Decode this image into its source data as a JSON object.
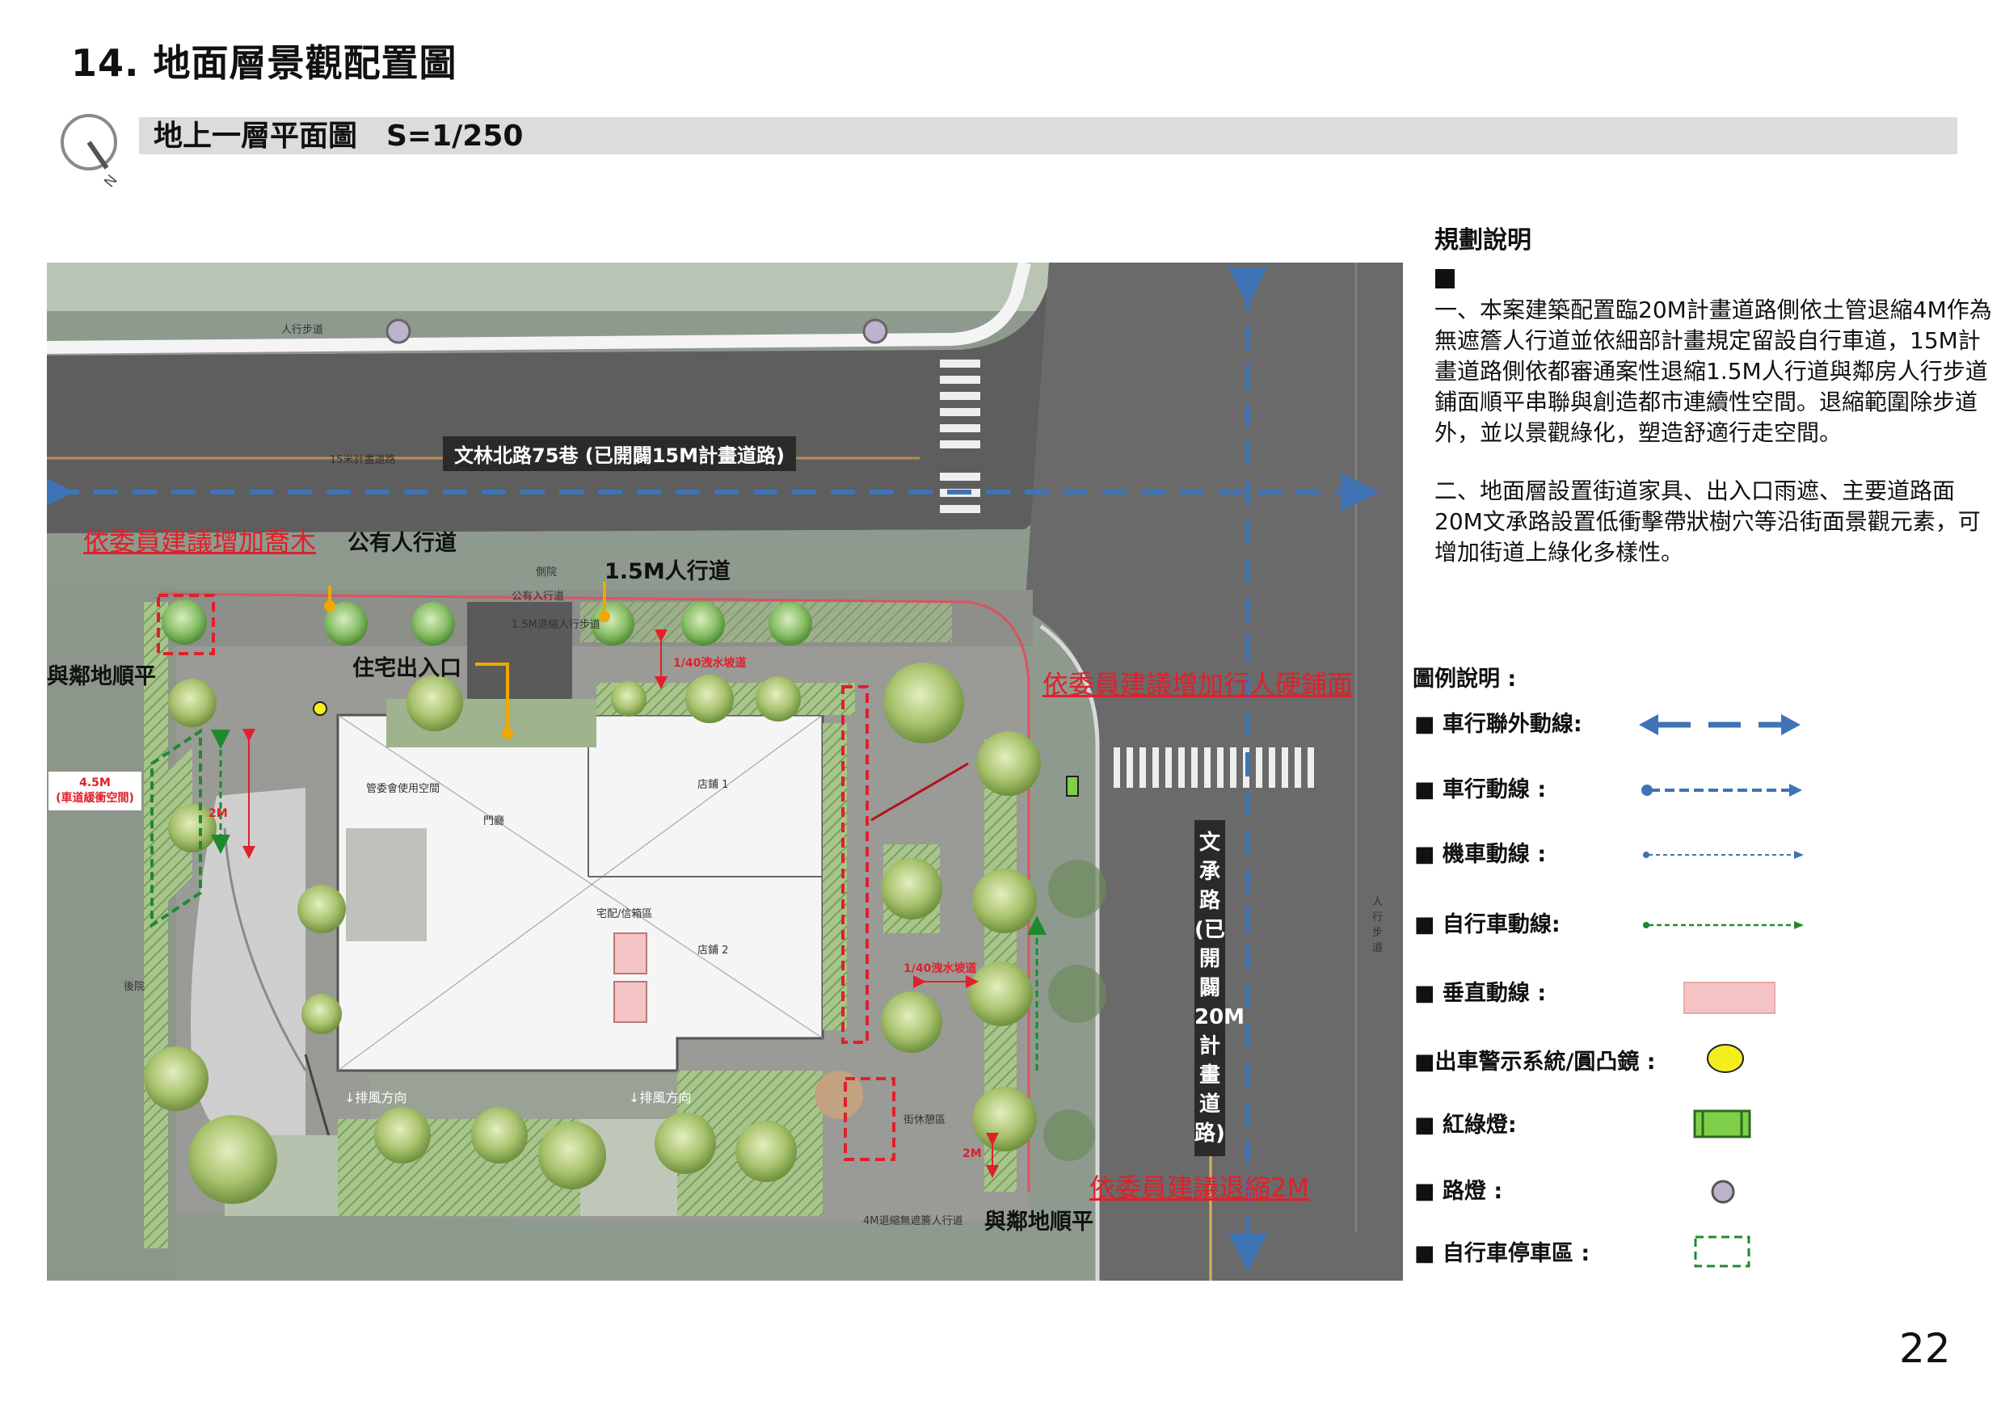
{
  "page": {
    "title": "14. 地面層景觀配置圖",
    "subtitle": "地上一層平面圖　S=1/250",
    "page_number": "22",
    "north_label": "N"
  },
  "notes": {
    "heading": "規劃說明",
    "paragraphs": [
      "一、本案建築配置臨20M計畫道路側依土管退縮4M作為無遮簷人行道並依細部計畫規定留設自行車道，15M計畫道路側依都審通案性退縮1.5M人行道與鄰房人行步道鋪面順平串聯與創造都市連續性空間。退縮範圍除步道外，並以景觀綠化，塑造舒適行走空間。",
      "二、地面層設置街道家具、出入口雨遮、主要道路面20M文承路設置低衝擊帶狀樹穴等沿街面景觀元素，可增加街道上綠化多樣性。"
    ]
  },
  "legend": {
    "heading": "圖例說明 :",
    "items": [
      {
        "label": "車行聯外動線:",
        "symbol": "double-arrow-icon"
      },
      {
        "label": "車行動線 :",
        "symbol": "vehicle-route-icon"
      },
      {
        "label": "機車動線 :",
        "symbol": "scooter-route-icon"
      },
      {
        "label": "自行車動線:",
        "symbol": "bicycle-route-icon"
      },
      {
        "label": "垂直動線 :",
        "symbol": "vertical-circulation-icon"
      },
      {
        "label": "出車警示系統/圓凸鏡 :",
        "symbol": "warning-mirror-icon"
      },
      {
        "label": "紅綠燈:",
        "symbol": "traffic-light-icon"
      },
      {
        "label": "路燈 :",
        "symbol": "street-lamp-icon"
      },
      {
        "label": "自行車停車區 :",
        "symbol": "bicycle-parking-icon"
      }
    ],
    "colors": {
      "vehicle_blue": "#3e73b5",
      "bicycle_green": "#1e8a2e",
      "vertical_pink": "#f4c4c4",
      "warning_yellow": "#f5ee1e",
      "lamp_purple": "#bdb3cc",
      "red_annotation": "#e0202a"
    }
  },
  "plan": {
    "labels": {
      "road_north": "文林北路75巷 (已開闢15M計畫道路)",
      "road_east": "文承路(已開闢20M計畫道路)",
      "add_trees": "依委員建議增加喬木",
      "public_walk": "公有人行道",
      "walk_15m": "1.5M人行道",
      "flush_west": "與鄰地順平",
      "residential_entrance": "住宅出入口",
      "hard_paving": "依委員建議增加行人硬鋪面",
      "setback_2m": "依委員建議退縮2M",
      "flush_south": "與鄰地順平",
      "buffer_45m": "4.5M",
      "buffer_note": "(車道緩衝空間)",
      "dim_2m_a": "2M",
      "dim_2m_b": "2M",
      "slope_a": "1/40洩水坡道",
      "slope_b": "1/40洩水坡道",
      "sidewalk_top": "人行步道",
      "road_15m_label": "15米計畫道路",
      "walk_east_a": "人行步道",
      "public_entrance": "公有入行道",
      "walk_15m_small": "1.5M退縮人行步道",
      "side_walk": "側院",
      "back_yard": "後院",
      "exhaust_a": "↓排風方向",
      "exhaust_b": "↓排風方向",
      "rest_area": "街休憩區",
      "walk_4m": "4M退縮無遮簷人行道",
      "shop1": "店鋪 1",
      "shop2": "店鋪 2",
      "lobby": "門廳",
      "mail": "宅配/信箱區",
      "mgmt": "管委會使用空間"
    }
  }
}
